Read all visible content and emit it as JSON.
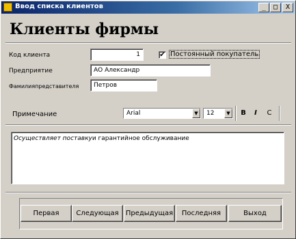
{
  "window": {
    "title": "Ввод списка клиентов",
    "controls": {
      "minimize": "_",
      "maximize": "□",
      "close": "X"
    }
  },
  "form": {
    "heading": "Клиенты фирмы",
    "client_code_label": "Код клиента",
    "client_code_value": "1",
    "regular_customer_label": "Постоянный покупатель",
    "regular_customer_checked": true,
    "regular_customer_mark": "✔",
    "company_label": "Предприятие",
    "company_value": "АО Александр",
    "rep_label": "Фамилияпредставителя",
    "rep_value": "Петров",
    "notes_label": "Примечание"
  },
  "toolbar": {
    "font_name": "Arial",
    "font_size": "12",
    "bold": "B",
    "italic": "I",
    "underline": "C",
    "dropdown_arrow": "▼"
  },
  "notes": {
    "italic_part": "Осуществляет поставку",
    "rest": "и гарантийное обслуживание"
  },
  "navigation": {
    "first": "Первая",
    "next": "Следующая",
    "prev": "Предыдущая",
    "last": "Последняя",
    "exit": "Выход"
  }
}
